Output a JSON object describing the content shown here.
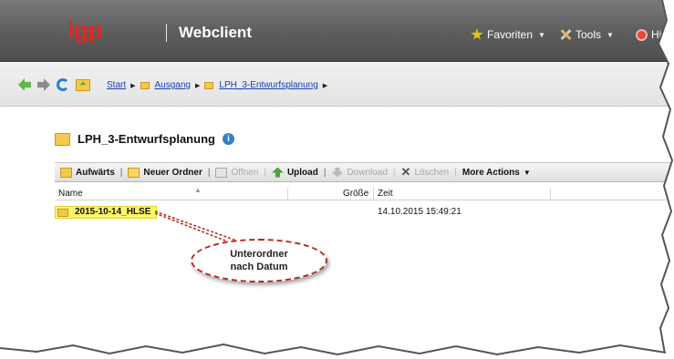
{
  "header": {
    "logo_text": "igp",
    "app_title": "Webclient",
    "nav": [
      {
        "label": "Favoriten",
        "icon": "star-icon"
      },
      {
        "label": "Tools",
        "icon": "tools-icon"
      },
      {
        "label": "Hilf",
        "icon": "help-icon"
      }
    ],
    "colors": {
      "logo": "#e2261f",
      "bar": "#5c5c5c"
    }
  },
  "breadcrumb": {
    "items": [
      "Start",
      "Ausgang",
      "LPH_3-Entwurfsplanung"
    ]
  },
  "folder": {
    "title": "LPH_3-Entwurfsplanung"
  },
  "toolbar": {
    "up_label": "Aufwärts",
    "new_folder_label": "Neuer Ordner",
    "open_label": "Öffnen",
    "upload_label": "Upload",
    "download_label": "Download",
    "delete_label": "Löschen",
    "more_label": "More Actions"
  },
  "table": {
    "columns": {
      "name": "Name",
      "size": "Größe",
      "time": "Zeit"
    },
    "rows": [
      {
        "name": "2015-10-14_HLSE",
        "size": "",
        "time": "14.10.2015 15:49:21",
        "selected": true
      }
    ]
  },
  "callout": {
    "line1": "Unterordner",
    "line2": "nach Datum"
  }
}
